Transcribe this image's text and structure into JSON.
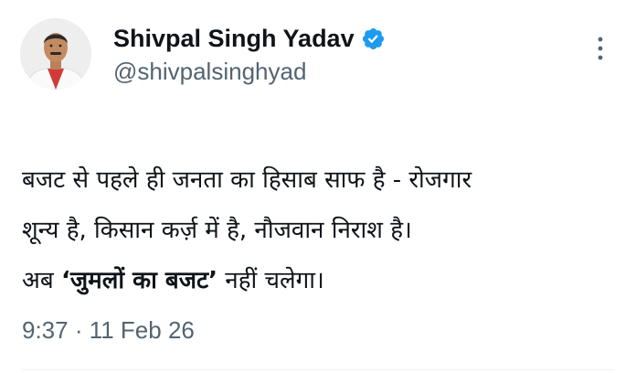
{
  "author": {
    "name": "Shivpal Singh Yadav",
    "handle": "@shivpalsinghyad",
    "verified_color": "#1d9bf0",
    "avatar_icon": "profile-photo"
  },
  "more_icon": "vertical-ellipsis-icon",
  "tweet": {
    "line1": "बजट से पहले ही जनता का हिसाब साफ है - रोजगार",
    "line2": "शून्य है, किसान कर्ज़ में है, नौजवान निराश है।",
    "line3_pre": "अब ",
    "line3_emph": "‘जुमलों का बजट’",
    "line3_post": " नहीं चलेगा।"
  },
  "timestamp": "9:37 · 11 Feb 26",
  "colors": {
    "text": "#0f1419",
    "secondary": "#536471",
    "accent": "#1d9bf0"
  }
}
